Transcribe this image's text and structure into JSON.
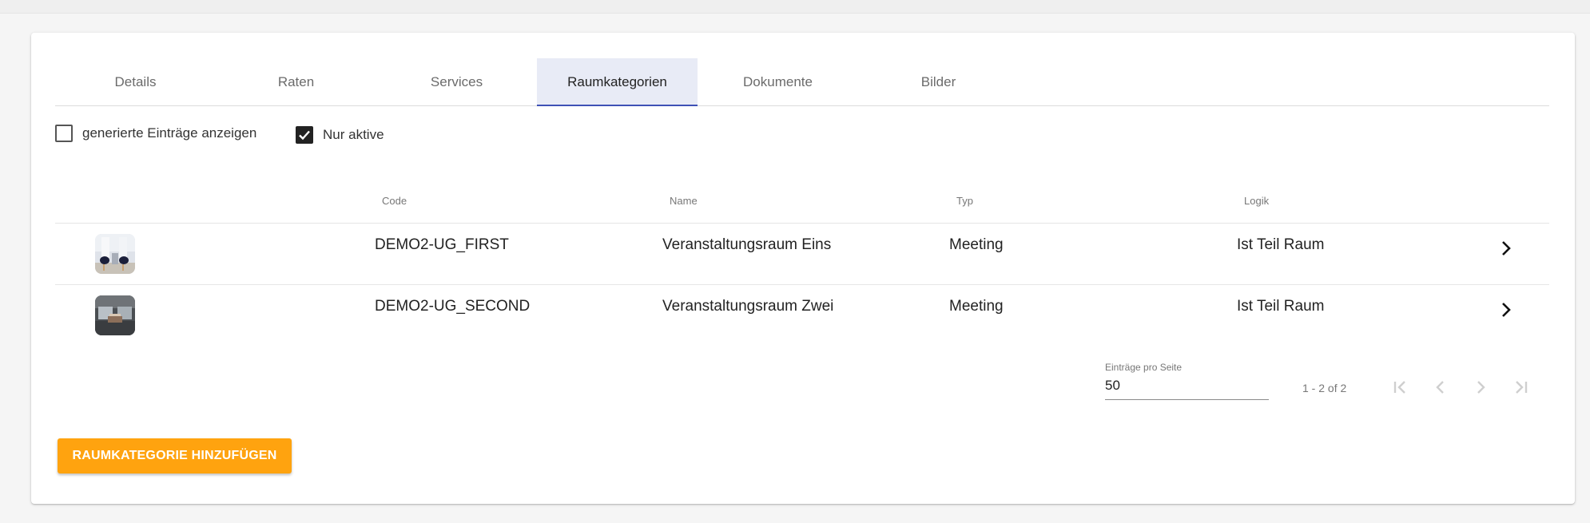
{
  "tabs": [
    {
      "label": "Details"
    },
    {
      "label": "Raten"
    },
    {
      "label": "Services"
    },
    {
      "label": "Raumkategorien"
    },
    {
      "label": "Dokumente"
    },
    {
      "label": "Bilder"
    }
  ],
  "active_tab": "Raumkategorien",
  "filters": {
    "show_generated": {
      "label": "generierte Einträge anzeigen",
      "checked": false
    },
    "only_active": {
      "label": "Nur aktive",
      "checked": true
    }
  },
  "table": {
    "columns": [
      "Code",
      "Name",
      "Typ",
      "Logik"
    ],
    "rows": [
      {
        "code": "DEMO2-UG_FIRST",
        "name": "Veranstaltungsraum Eins",
        "type": "Meeting",
        "logic": "Ist Teil Raum"
      },
      {
        "code": "DEMO2-UG_SECOND",
        "name": "Veranstaltungsraum Zwei",
        "type": "Meeting",
        "logic": "Ist Teil Raum"
      }
    ]
  },
  "paginator": {
    "label": "Einträge pro Seite",
    "page_size": "50",
    "range": "1 - 2 of 2"
  },
  "actions": {
    "add_label": "RAUMKATEGORIE HINZUFÜGEN"
  },
  "colors": {
    "accent": "#ffa30f",
    "tab_active_bg": "#e8ebf6",
    "tab_indicator": "#3f51b5"
  }
}
